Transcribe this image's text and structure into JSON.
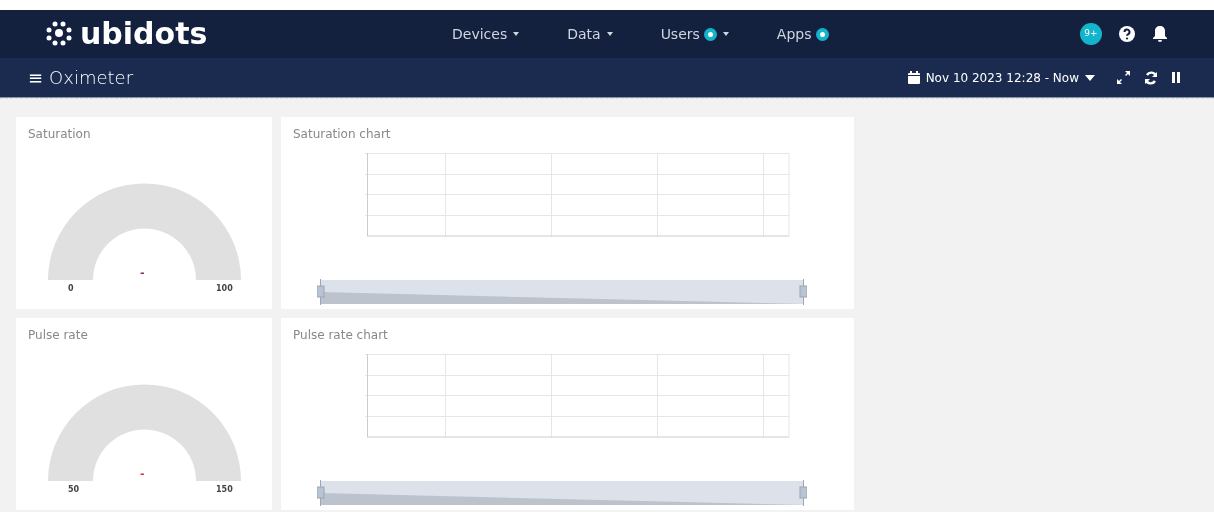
{
  "brand": "ubidots",
  "nav": [
    {
      "label": "Devices",
      "star": false,
      "caret": true
    },
    {
      "label": "Data",
      "star": false,
      "caret": true
    },
    {
      "label": "Users",
      "star": true,
      "caret": true
    },
    {
      "label": "Apps",
      "star": true,
      "caret": false
    }
  ],
  "notifications": "9+",
  "dashboard": {
    "menu": "≡",
    "title": "Oximeter",
    "date_range": "Nov 10 2023 12:28 - Now"
  },
  "rows": [
    {
      "gauge": {
        "title": "Saturation",
        "value": "-",
        "color": "#7b2d6b",
        "min": "0",
        "max": "100"
      },
      "chart": {
        "title": "Saturation chart"
      }
    },
    {
      "gauge": {
        "title": "Pulse rate",
        "value": "-",
        "color": "#e0312b",
        "min": "50",
        "max": "150"
      },
      "chart": {
        "title": "Pulse rate chart"
      }
    }
  ]
}
